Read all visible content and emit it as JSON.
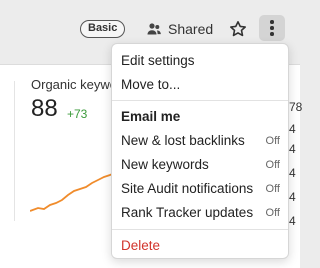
{
  "topbar": {
    "badge": "Basic",
    "shared_label": "Shared"
  },
  "card": {
    "title": "Organic keywo",
    "value": "88",
    "delta": "+73",
    "right_values": [
      "78",
      "4",
      "4",
      "4",
      "4",
      "4"
    ]
  },
  "menu": {
    "edit_settings": "Edit settings",
    "move_to": "Move to...",
    "email_heading": "Email me",
    "items": [
      {
        "label": "New & lost backlinks",
        "state": "Off"
      },
      {
        "label": "New keywords",
        "state": "Off"
      },
      {
        "label": "Site Audit notifications",
        "state": "Off"
      },
      {
        "label": "Rank Tracker updates",
        "state": "Off"
      }
    ],
    "delete": "Delete"
  },
  "colors": {
    "accent_line": "#f08c2c",
    "delete": "#d2342c",
    "delta_green": "#3a9a3a"
  }
}
